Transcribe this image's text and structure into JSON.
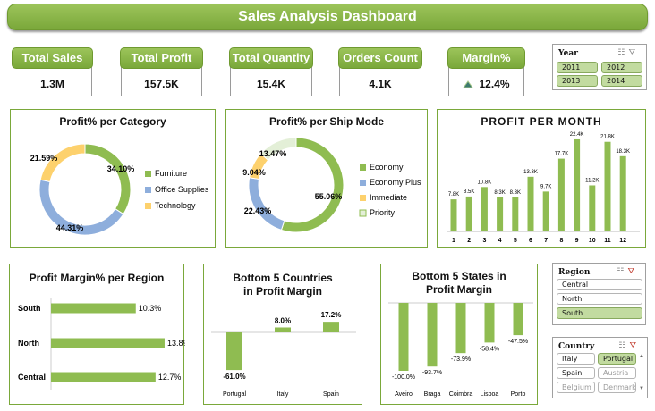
{
  "title": "Sales Analysis Dashboard",
  "kpis": [
    {
      "label": "Total Sales",
      "value": "1.3M"
    },
    {
      "label": "Total Profit",
      "value": "157.5K"
    },
    {
      "label": "Total Quantity",
      "value": "15.4K"
    },
    {
      "label": "Orders Count",
      "value": "4.1K"
    },
    {
      "label": "Margin%",
      "value": "12.4%",
      "icon": "triangle-up-icon"
    }
  ],
  "year_slicer": {
    "title": "Year",
    "items": [
      "2011",
      "2012",
      "2013",
      "2014"
    ],
    "selected": [
      "2011",
      "2012",
      "2013",
      "2014"
    ]
  },
  "region_slicer": {
    "title": "Region",
    "items": [
      "Central",
      "North",
      "South"
    ],
    "selected": [
      "South"
    ]
  },
  "country_slicer": {
    "title": "Country",
    "items": [
      "Italy",
      "Portugal",
      "Spain",
      "Austria",
      "Belgium",
      "Denmark"
    ],
    "selected": [
      "Portugal"
    ],
    "disabled": [
      "Austria",
      "Belgium",
      "Denmark"
    ]
  },
  "colors": {
    "green": "#8fbc51",
    "blue": "#8eaedc",
    "yellow": "#fdd16d",
    "light": "#e3efd7",
    "accent": "#7aa83a"
  },
  "chart_data": [
    {
      "type": "pie",
      "variant": "donut",
      "title": "Profit% per Category",
      "labels": [
        "Furniture",
        "Office Supplies",
        "Technology"
      ],
      "values": [
        34.1,
        44.31,
        21.59
      ],
      "value_labels": [
        "34.10%",
        "44.31%",
        "21.59%"
      ],
      "colors": [
        "#8fbc51",
        "#8eaedc",
        "#fdd16d"
      ],
      "legend": "right"
    },
    {
      "type": "pie",
      "variant": "donut",
      "title": "Profit% per Ship Mode",
      "labels": [
        "Economy",
        "Economy Plus",
        "Immediate",
        "Priority"
      ],
      "values": [
        55.06,
        22.43,
        9.04,
        13.47
      ],
      "value_labels": [
        "55.06%",
        "22.43%",
        "9.04%",
        "13.47%"
      ],
      "colors": [
        "#8fbc51",
        "#8eaedc",
        "#fdd16d",
        "#e3efd7"
      ],
      "legend": "right"
    },
    {
      "type": "bar",
      "title": "PROFIT PER MONTH",
      "categories": [
        "1",
        "2",
        "3",
        "4",
        "5",
        "6",
        "7",
        "8",
        "9",
        "10",
        "11",
        "12"
      ],
      "values": [
        7.8,
        8.5,
        10.8,
        8.3,
        8.3,
        13.3,
        9.7,
        17.7,
        22.4,
        11.2,
        21.8,
        18.3
      ],
      "value_labels": [
        "7.8K",
        "8.5K",
        "10.8K",
        "8.3K",
        "8.3K",
        "13.3K",
        "9.7K",
        "17.7K",
        "22.4K",
        "11.2K",
        "21.8K",
        "18.3K"
      ],
      "ylim": [
        0,
        24
      ]
    },
    {
      "type": "bar",
      "orientation": "horizontal",
      "title": "Profit Margin% per Region",
      "categories": [
        "South",
        "North",
        "Central"
      ],
      "values": [
        10.3,
        13.8,
        12.7
      ],
      "value_labels": [
        "10.3%",
        "13.8%",
        "12.7%"
      ],
      "xlim": [
        0,
        14
      ]
    },
    {
      "type": "bar",
      "title": "Bottom 5 Countries in Profit Margin",
      "categories": [
        "Portugal",
        "Italy",
        "Spain"
      ],
      "values": [
        -61.0,
        8.0,
        17.2
      ],
      "value_labels": [
        "-61.0%",
        "8.0%",
        "17.2%"
      ],
      "ylim": [
        -65,
        20
      ]
    },
    {
      "type": "bar",
      "title": "Bottom 5 States in Profit Margin",
      "categories": [
        "Aveiro",
        "Braga",
        "Coimbra",
        "Lisboa",
        "Porto"
      ],
      "values": [
        -100.0,
        -93.7,
        -73.9,
        -58.4,
        -47.5
      ],
      "value_labels": [
        "-100.0%",
        "-93.7%",
        "-73.9%",
        "-58.4%",
        "-47.5%"
      ],
      "ylim": [
        -100,
        0
      ]
    }
  ]
}
